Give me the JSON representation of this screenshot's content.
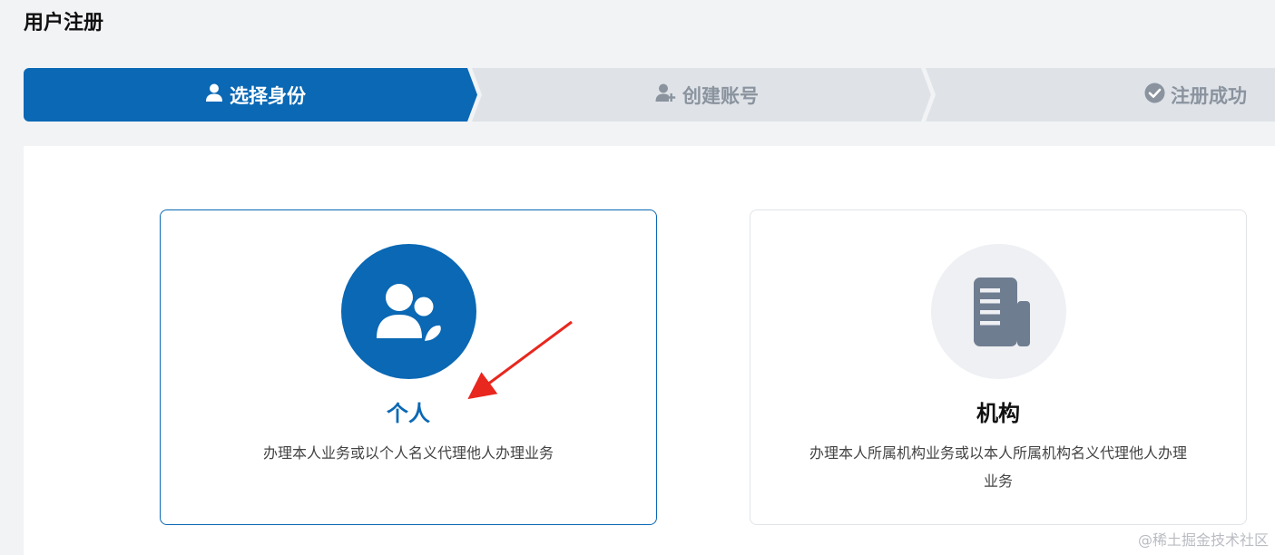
{
  "page": {
    "title": "用户注册"
  },
  "steps": [
    {
      "label": "选择身份",
      "icon": "user-icon",
      "state": "active"
    },
    {
      "label": "创建账号",
      "icon": "user-plus-icon",
      "state": "pending"
    },
    {
      "label": "注册成功",
      "icon": "check-circle-icon",
      "state": "pending"
    }
  ],
  "cards": {
    "personal": {
      "title": "个人",
      "description": "办理本人业务或以个人名义代理他人办理业务",
      "icon": "users-icon",
      "selected": true
    },
    "organization": {
      "title": "机构",
      "description": "办理本人所属机构业务或以本人所属机构名义代理他人办理业务",
      "icon": "building-icon",
      "selected": false
    }
  },
  "watermark": "@稀土掘金技术社区",
  "colors": {
    "primary": "#0a68b4",
    "step_inactive_bg": "#dfe3e8",
    "step_inactive_text": "#8a939e",
    "arrow": "#e8271e"
  }
}
